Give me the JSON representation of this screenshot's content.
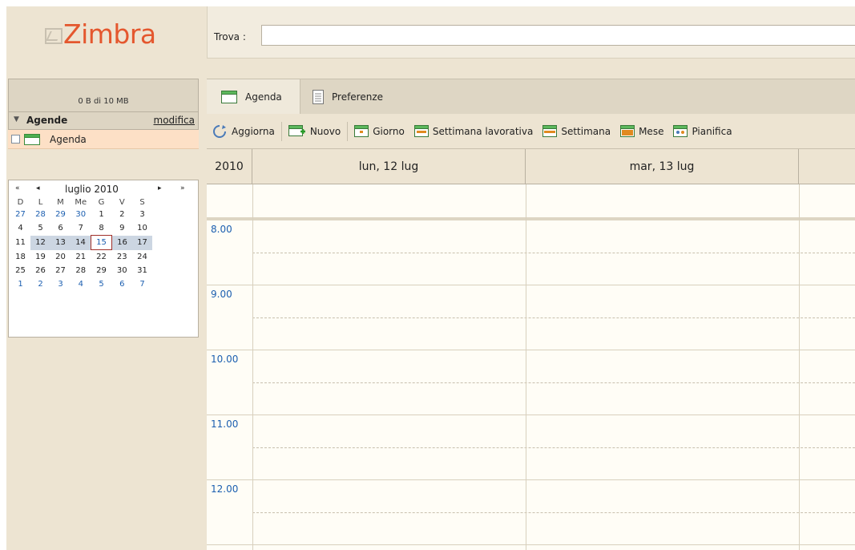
{
  "logo": {
    "text": "Zimbra"
  },
  "search": {
    "label": "Trova :",
    "value": ""
  },
  "quota": {
    "text": "0 B di 10 MB"
  },
  "tree": {
    "title": "Agende",
    "edit_label": "modifica",
    "item_label": "Agenda"
  },
  "mini_calendar": {
    "month_label": "luglio 2010",
    "nav": {
      "prev_year": "«",
      "prev_month": "◂",
      "next_month": "▸",
      "next_year": "»"
    },
    "weekdays": [
      "D",
      "L",
      "M",
      "Me",
      "G",
      "V",
      "S"
    ],
    "weeks": [
      [
        "27",
        "28",
        "29",
        "30",
        "1",
        "2",
        "3"
      ],
      [
        "4",
        "5",
        "6",
        "7",
        "8",
        "9",
        "10"
      ],
      [
        "11",
        "12",
        "13",
        "14",
        "15",
        "16",
        "17"
      ],
      [
        "18",
        "19",
        "20",
        "21",
        "22",
        "23",
        "24"
      ],
      [
        "25",
        "26",
        "27",
        "28",
        "29",
        "30",
        "31"
      ],
      [
        "1",
        "2",
        "3",
        "4",
        "5",
        "6",
        "7"
      ]
    ],
    "selected_week_index": 2,
    "today": "15"
  },
  "tabs": {
    "agenda": "Agenda",
    "preferences": "Preferenze"
  },
  "toolbar": {
    "refresh": "Aggiorna",
    "new": "Nuovo",
    "day": "Giorno",
    "work_week": "Settimana lavorativa",
    "week": "Settimana",
    "month": "Mese",
    "schedule": "Pianifica"
  },
  "grid": {
    "year": "2010",
    "days": [
      "lun, 12 lug",
      "mar, 13 lug",
      ""
    ],
    "hours": [
      "8.00",
      "9.00",
      "10.00",
      "11.00",
      "12.00"
    ]
  },
  "colors": {
    "logo": "#e4572e",
    "hour_label": "#1c5fb0",
    "today_border": "#a0302a",
    "selected_week": "#ccd6e2",
    "calendar_item_bg": "#fde0c6"
  }
}
